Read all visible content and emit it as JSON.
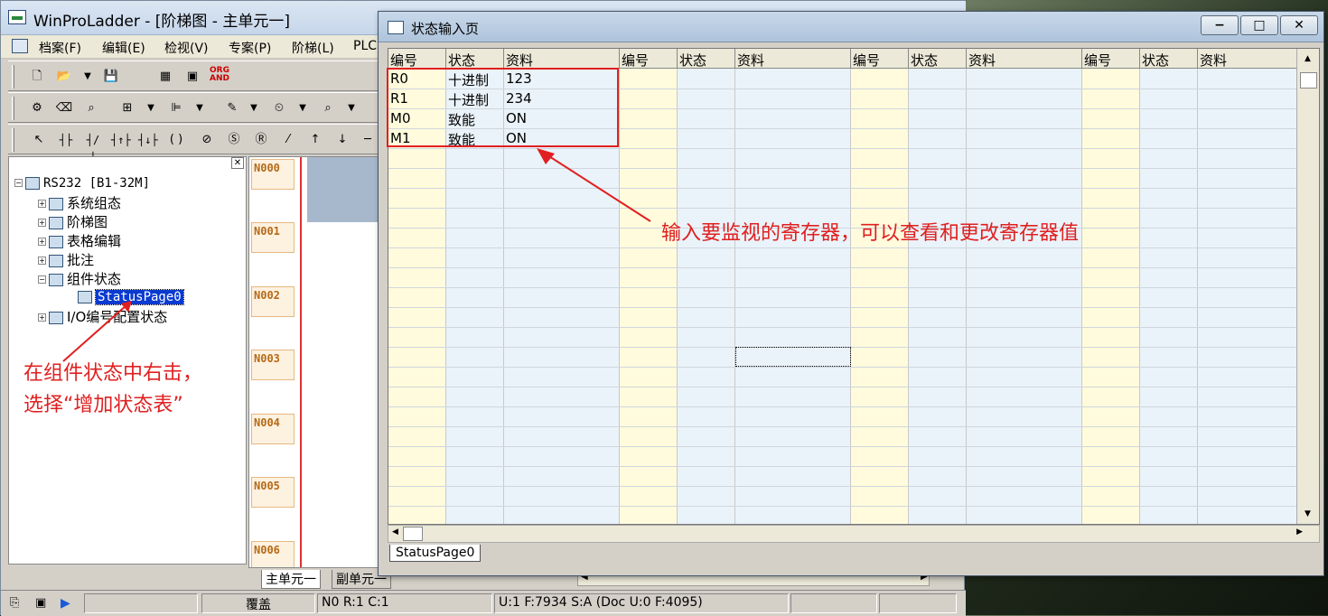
{
  "main": {
    "title": "WinProLadder - [阶梯图 - 主单元一]",
    "menu": [
      "档案(F)",
      "编辑(E)",
      "检视(V)",
      "专案(P)",
      "阶梯(L)",
      "PLC"
    ],
    "tree": {
      "root": "RS232 [B1-32M]",
      "items": [
        "系统组态",
        "阶梯图",
        "表格编辑",
        "批注",
        "组件状态"
      ],
      "selected": "StatusPage0",
      "last": "I/O编号配置状态"
    },
    "rungs": [
      "N000",
      "N001",
      "N002",
      "N003",
      "N004",
      "N005",
      "N006"
    ],
    "tabs": [
      "主单元一",
      "副单元一"
    ],
    "status": {
      "mode": "覆盖",
      "pos": "N0 R:1 C:1",
      "usage": "U:1 F:7934 S:A (Doc U:0 F:4095)"
    },
    "toolbar3": "ORG AND"
  },
  "statwin": {
    "title": "状态输入页",
    "headers": [
      "编号",
      "状态",
      "资料"
    ],
    "rows": [
      {
        "id": "R0",
        "state": "十进制",
        "value": "123"
      },
      {
        "id": "R1",
        "state": "十进制",
        "value": "234"
      },
      {
        "id": "M0",
        "state": "致能",
        "value": "ON"
      },
      {
        "id": "M1",
        "state": "致能",
        "value": "ON"
      }
    ],
    "sheet_tab": "StatusPage0"
  },
  "annotations": {
    "grid_note": "输入要监视的寄存器，可以查看和更改寄存器值",
    "tree_note_1": "在组件状态中右击，",
    "tree_note_2": "选择“增加状态表”"
  },
  "colors": {
    "annotation": "#e02020",
    "yellow_col": "#fffbdc",
    "blue_col": "#eaf3fa",
    "rung_text": "#b56a16"
  },
  "icons": [
    "app-icon",
    "new-file-icon",
    "open-folder-icon",
    "save-icon",
    "cursor-icon",
    "minimize-icon",
    "maximize-icon",
    "close-icon",
    "play-icon"
  ]
}
